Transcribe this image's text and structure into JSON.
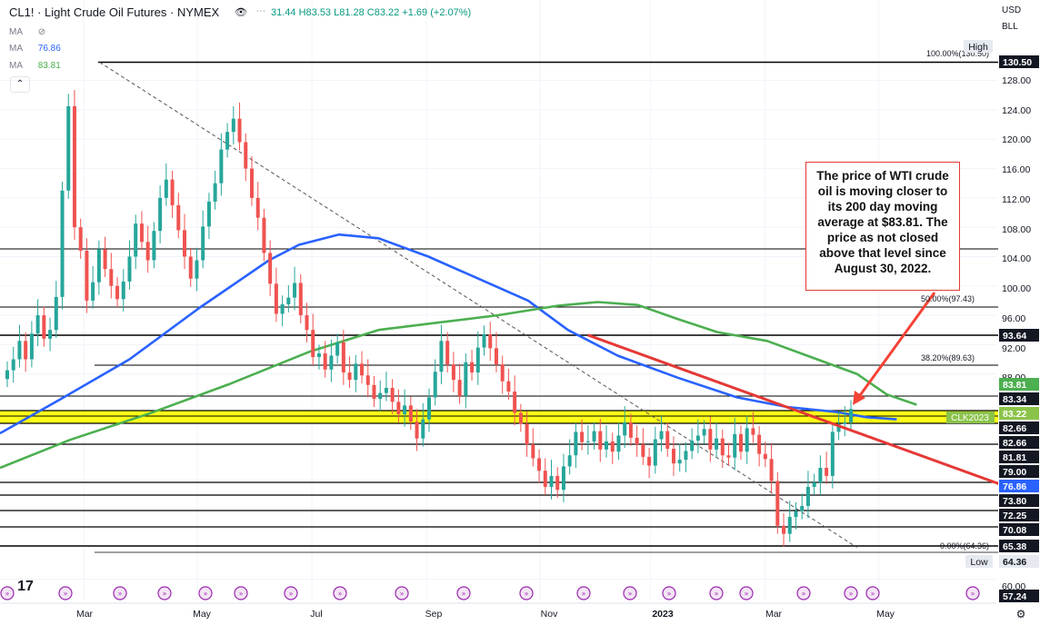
{
  "header": {
    "symbol_title": "CL1! · Light Crude Oil Futures · NYMEX",
    "ohlc_text": "31.44 H83.53 L81.28 C83.22 +1.69 (+2.07%)",
    "ma_rows": [
      {
        "label": "MA",
        "value": ""
      },
      {
        "label": "MA",
        "value": "76.86",
        "color": "#2962ff"
      },
      {
        "label": "MA",
        "value": "83.81",
        "color": "#4caf50"
      }
    ],
    "currency": "USD",
    "unit": "BLL"
  },
  "callout": {
    "text": "The price of WTI crude oil is moving closer to its 200 day moving average at $83.81. The price as not closed above that level since August 30, 2022."
  },
  "chart_data": {
    "type": "line",
    "title": "CL1! · Light Crude Oil Futures · NYMEX",
    "ylim": [
      57,
      131
    ],
    "x_ticks": [
      "Mar",
      "May",
      "Jul",
      "Sep",
      "Nov",
      "2023",
      "Mar",
      "May"
    ],
    "y_ticks": [
      128.0,
      124.0,
      120.0,
      116.0,
      112.0,
      108.0,
      104.0,
      100.0,
      96.0,
      92.0,
      88.0,
      60.0
    ],
    "price_labels": [
      {
        "text": "130.50",
        "value": 130.5,
        "style": "dark"
      },
      {
        "text": "93.64",
        "value": 93.64,
        "style": "dark"
      },
      {
        "text": "83.81",
        "value": 83.81,
        "style": "green"
      },
      {
        "text": "83.34",
        "value": 83.34,
        "style": "dark"
      },
      {
        "text": "83.22",
        "value": 83.22,
        "style": "lime"
      },
      {
        "text": "82.66",
        "value": 82.66,
        "style": "dark"
      },
      {
        "text": "82.66",
        "value": 82.66,
        "style": "dark"
      },
      {
        "text": "81.81",
        "value": 81.81,
        "style": "dark"
      },
      {
        "text": "79.00",
        "value": 79.0,
        "style": "dark"
      },
      {
        "text": "76.86",
        "value": 76.86,
        "style": "blue"
      },
      {
        "text": "73.80",
        "value": 73.8,
        "style": "dark"
      },
      {
        "text": "72.25",
        "value": 72.25,
        "style": "dark"
      },
      {
        "text": "70.08",
        "value": 70.08,
        "style": "dark"
      },
      {
        "text": "65.38",
        "value": 65.38,
        "style": "dark"
      },
      {
        "text": "64.36",
        "value": 64.36,
        "style": "light"
      },
      {
        "text": "57.24",
        "value": 57.24,
        "style": "dark"
      }
    ],
    "horizontal_levels": [
      130.5,
      105.3,
      97.43,
      93.64,
      89.63,
      84.0,
      82.66,
      81.81,
      79.0,
      76.86,
      73.8,
      72.25,
      70.08,
      65.38,
      64.36
    ],
    "highlight_zone": {
      "label": "CLK2023",
      "low": 82.66,
      "high": 83.34,
      "color": "#ffff00"
    },
    "fib_labels": [
      {
        "text": "100.00%(130.50)",
        "value": 130.5
      },
      {
        "text": "50.00%(97.43)",
        "value": 97.43
      },
      {
        "text": "38.20%(89.63)",
        "value": 89.63
      },
      {
        "text": "0.00%(64.36)",
        "value": 64.36
      }
    ],
    "high_label": "High",
    "low_label": "Low",
    "series": [
      {
        "name": "MA",
        "value_label": "76.86",
        "color": "#2962ff",
        "points": [
          [
            0,
            79.9
          ],
          [
            0.06,
            84.5
          ],
          [
            0.13,
            90
          ],
          [
            0.2,
            97
          ],
          [
            0.27,
            103.5
          ],
          [
            0.3,
            105.6
          ],
          [
            0.34,
            107
          ],
          [
            0.38,
            106.5
          ],
          [
            0.43,
            104
          ],
          [
            0.48,
            101
          ],
          [
            0.53,
            98
          ],
          [
            0.57,
            94
          ],
          [
            0.62,
            90.5
          ],
          [
            0.68,
            87.5
          ],
          [
            0.74,
            84.8
          ],
          [
            0.79,
            83.5
          ],
          [
            0.84,
            82.8
          ],
          [
            0.87,
            82.1
          ],
          [
            0.9,
            81.81
          ]
        ]
      },
      {
        "name": "MA",
        "value_label": "83.81",
        "color": "#4caf50",
        "points": [
          [
            0,
            75.2
          ],
          [
            0.07,
            79
          ],
          [
            0.15,
            82.6
          ],
          [
            0.23,
            86.6
          ],
          [
            0.31,
            91
          ],
          [
            0.38,
            94
          ],
          [
            0.44,
            95
          ],
          [
            0.5,
            96
          ],
          [
            0.56,
            97.3
          ],
          [
            0.6,
            97.8
          ],
          [
            0.64,
            97.4
          ],
          [
            0.68,
            95.5
          ],
          [
            0.72,
            93.7
          ],
          [
            0.77,
            92.5
          ],
          [
            0.81,
            90.5
          ],
          [
            0.86,
            88
          ],
          [
            0.89,
            85.2
          ],
          [
            0.92,
            83.81
          ]
        ]
      }
    ],
    "trendlines": [
      {
        "color": "#555555",
        "dashed": true,
        "from": [
          0.1,
          130.5
        ],
        "to": [
          0.86,
          64.36
        ]
      },
      {
        "color": "#e53935",
        "dashed": false,
        "from": [
          0.59,
          93.3
        ],
        "to": [
          1.06,
          70.2
        ]
      },
      {
        "color": "#f44336",
        "dashed": false,
        "arrow": true,
        "from": [
          0.995,
          99.2
        ],
        "to": [
          0.915,
          84.3
        ]
      }
    ],
    "candles_close": [
      88.5,
      90,
      92.5,
      90,
      93.5,
      96,
      92.8,
      94,
      98.5,
      113,
      124.5,
      108,
      104.8,
      98,
      100.5,
      105,
      102.3,
      100,
      98.2,
      100.6,
      104,
      108.5,
      106,
      103.5,
      107.5,
      112,
      114.5,
      111,
      107.6,
      104,
      101,
      103.5,
      108.1,
      111.5,
      114,
      118.6,
      121,
      122.8,
      119.6,
      116,
      112,
      109.3,
      104.5,
      100.3,
      96.2,
      97.5,
      98.4,
      100.4,
      96,
      94,
      90.3,
      90.8,
      88.6,
      90.5,
      92.3,
      88.2,
      87.2,
      89.4,
      87.8,
      86.5,
      84.6,
      85.4,
      86.1,
      84.2,
      82.5,
      83.7,
      81.5,
      79.2,
      81.8,
      84.8,
      88.3,
      92.5,
      89.3,
      87.2,
      85,
      89.6,
      88.2,
      91.6,
      93.4,
      91.5,
      89.3,
      87,
      85.6,
      82.7,
      81.2,
      78.4,
      76.5,
      74.8,
      72.6,
      74.1,
      72.2,
      75.4,
      76.9,
      80.1,
      78.7,
      78.8,
      80.2,
      77.7,
      78.8,
      77.4,
      79.6,
      81.4,
      79.3,
      78.4,
      76.7,
      75.5,
      79.1,
      80.2,
      77.8,
      75.8,
      76.3,
      77.5,
      78.9,
      79.6,
      80.5,
      77.7,
      79.2,
      76.9,
      76.6,
      79.8,
      77.4,
      80.6,
      79.7,
      77.1,
      76.4,
      73.4,
      67.3,
      66.2,
      68.5,
      69.3,
      70,
      72.6,
      73.2,
      75.2,
      74.1,
      80.1,
      81.2,
      81.4,
      83.22
    ],
    "events_row_count": 24
  }
}
